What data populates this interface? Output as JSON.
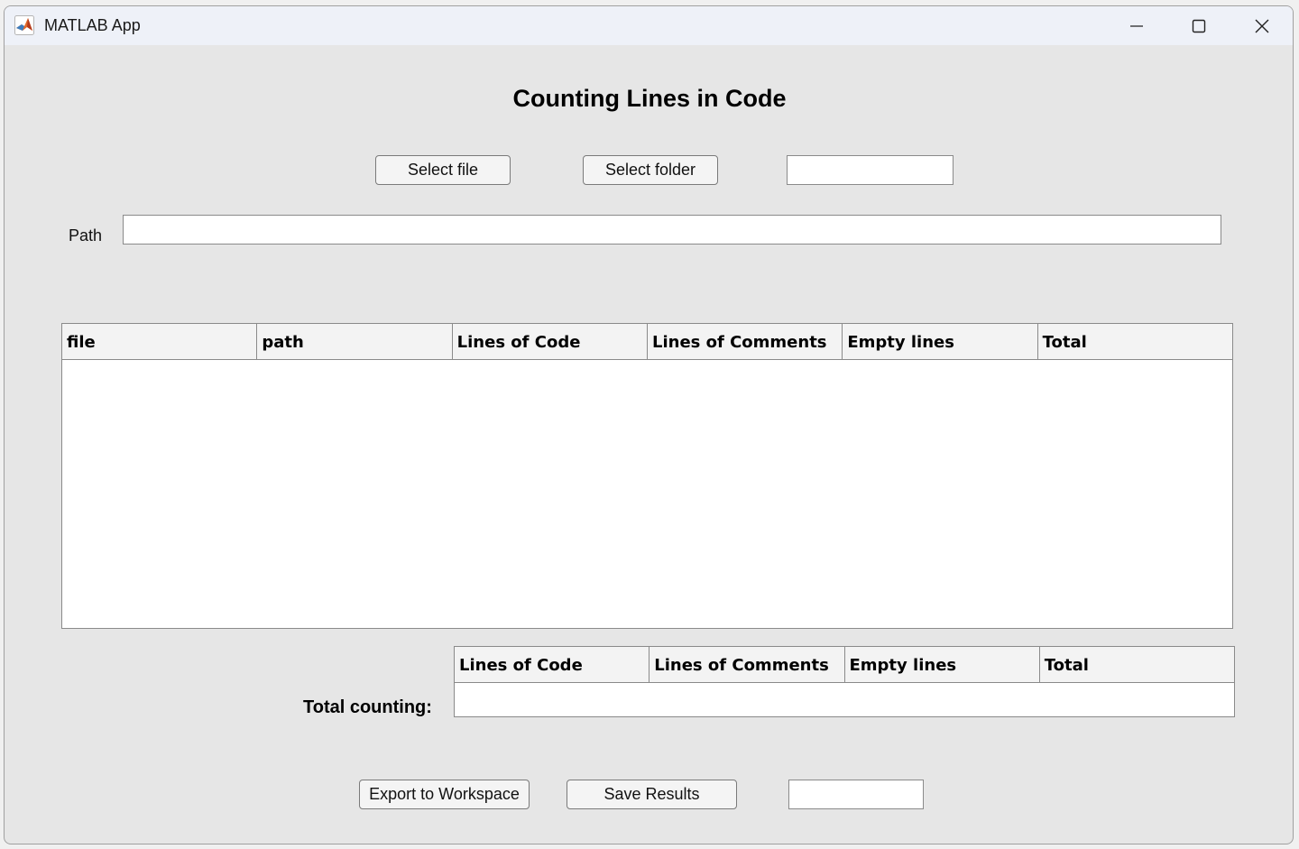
{
  "window": {
    "title": "MATLAB App"
  },
  "icons": {
    "app": "matlab-logo-icon",
    "minimize": "minimize-icon",
    "maximize": "maximize-icon",
    "close": "close-icon"
  },
  "main": {
    "heading": "Counting Lines in Code",
    "select_file_label": "Select file",
    "select_folder_label": "Select folder",
    "status_field_value": "",
    "path_label": "Path",
    "path_value": ""
  },
  "results_table": {
    "columns": [
      "file",
      "path",
      "Lines of Code",
      "Lines of Comments",
      "Empty lines",
      "Total"
    ],
    "rows": []
  },
  "totals": {
    "label": "Total counting:",
    "columns": [
      "Lines of Code",
      "Lines of Comments",
      "Empty lines",
      "Total"
    ],
    "rows": []
  },
  "footer": {
    "export_label": "Export to Workspace",
    "save_label": "Save Results",
    "status_field_value": ""
  },
  "colors": {
    "window_bg": "#e6e6e6",
    "titlebar_bg": "#eef1f8",
    "header_bg": "#f3f3f3",
    "border": "#8a8a8a"
  }
}
